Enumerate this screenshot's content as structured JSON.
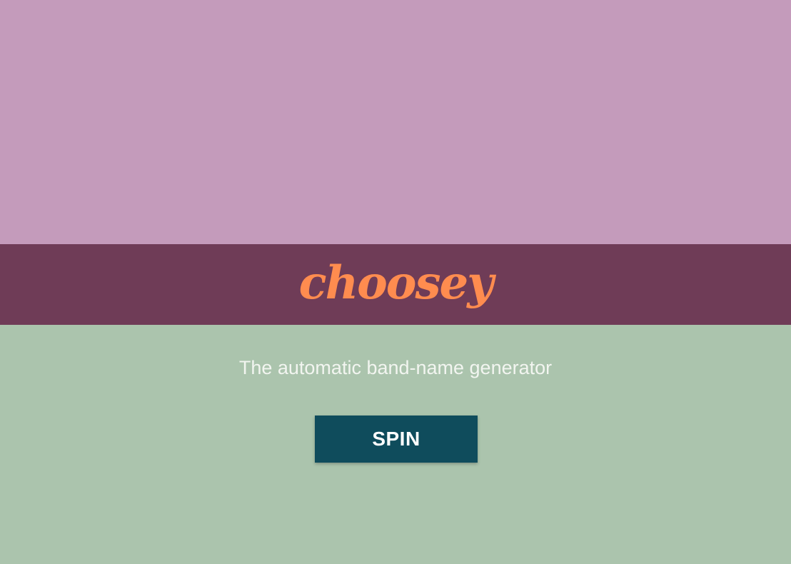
{
  "app": {
    "logo_text": "choosey",
    "tagline": "The automatic band-name generator"
  },
  "actions": {
    "spin_label": "SPIN"
  },
  "colors": {
    "top_panel": "#c49bbb",
    "brand_bar": "#6f3c57",
    "logo": "#ff8c4f",
    "bottom_panel": "#abc4ad",
    "button": "#0f4c5c",
    "tagline": "#f2f5f0"
  }
}
